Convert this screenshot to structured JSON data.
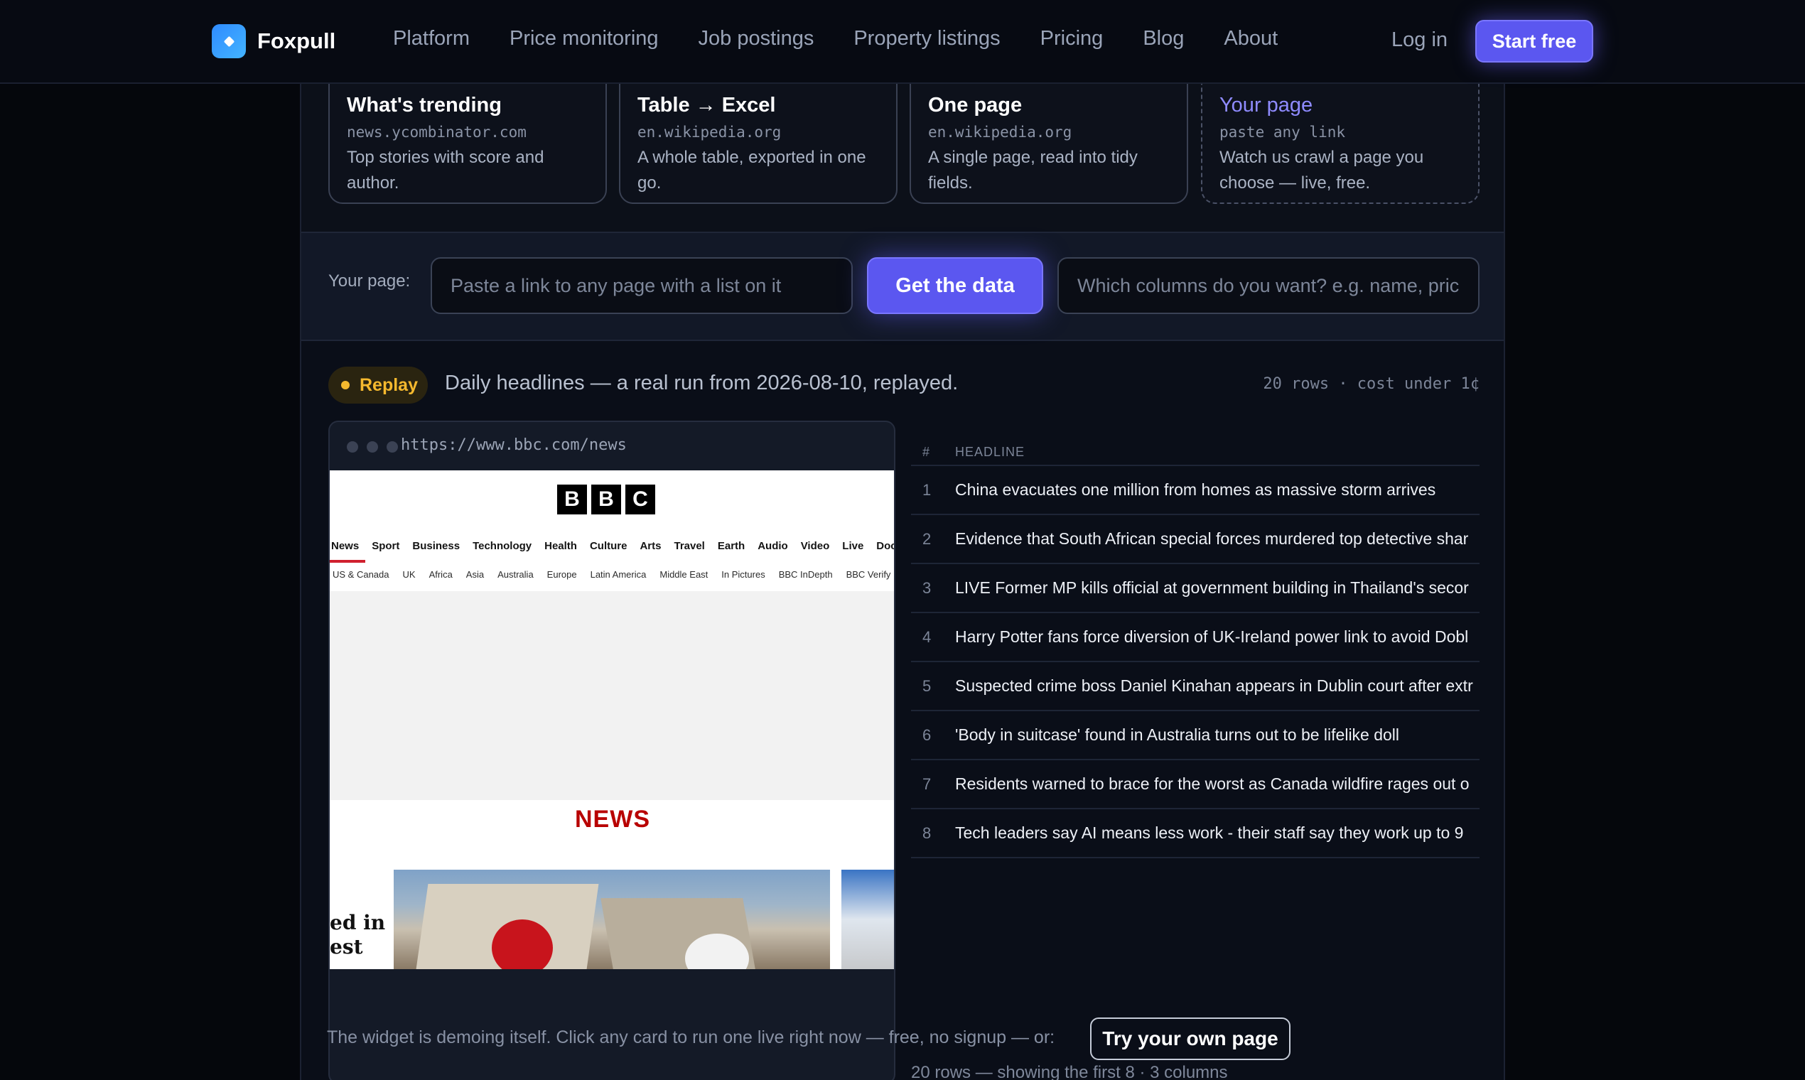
{
  "nav": {
    "brand": "Foxpull",
    "links": [
      "Platform",
      "Price monitoring",
      "Job postings",
      "Property listings",
      "Pricing",
      "Blog",
      "About"
    ],
    "login": "Log in",
    "cta": "Start free"
  },
  "cards": [
    {
      "title": "What's trending",
      "domain": "news.ycombinator.com",
      "desc": "Top stories with score and author."
    },
    {
      "title": "Table → Excel",
      "domain": "en.wikipedia.org",
      "desc": "A whole table, exported in one go."
    },
    {
      "title": "One page",
      "domain": "en.wikipedia.org",
      "desc": "A single page, read into tidy fields."
    },
    {
      "title": "Your page",
      "domain": "paste any link",
      "desc": "Watch us crawl a page you choose — live, free."
    }
  ],
  "input_row": {
    "label": "Your page:",
    "url_placeholder": "Paste a link to any page with a list on it",
    "button": "Get the data",
    "columns_placeholder": "Which columns do you want? e.g. name, price"
  },
  "replay": {
    "badge": "Replay",
    "title": "Daily headlines — a real run from 2026-08-10, replayed.",
    "meta": "20 rows · cost under 1¢"
  },
  "browser": {
    "url": "https://www.bbc.com/news",
    "logo_letters": [
      "B",
      "B",
      "C"
    ],
    "nav": [
      "News",
      "Sport",
      "Business",
      "Technology",
      "Health",
      "Culture",
      "Arts",
      "Travel",
      "Earth",
      "Audio",
      "Video",
      "Live",
      "Documentaries"
    ],
    "subnav": [
      "US & Canada",
      "UK",
      "Africa",
      "Asia",
      "Australia",
      "Europe",
      "Latin America",
      "Middle East",
      "In Pictures",
      "BBC InDepth",
      "BBC Verify"
    ],
    "section": "NEWS",
    "edge_text": [
      "ed in",
      "est"
    ]
  },
  "table": {
    "headers": [
      "#",
      "HEADLINE"
    ],
    "rows": [
      {
        "n": "1",
        "headline": "China evacuates one million from homes as massive storm arrives"
      },
      {
        "n": "2",
        "headline": "Evidence that South African special forces murdered top detective shar"
      },
      {
        "n": "3",
        "headline": "LIVE Former MP kills official at government building in Thailand's secor"
      },
      {
        "n": "4",
        "headline": "Harry Potter fans force diversion of UK-Ireland power link to avoid Dobl"
      },
      {
        "n": "5",
        "headline": "Suspected crime boss Daniel Kinahan appears in Dublin court after extr"
      },
      {
        "n": "6",
        "headline": "'Body in suitcase' found in Australia turns out to be lifelike doll"
      },
      {
        "n": "7",
        "headline": "Residents warned to brace for the worst as Canada wildfire rages out o"
      },
      {
        "n": "8",
        "headline": "Tech leaders say AI means less work - their staff say they work up to 9"
      }
    ],
    "footer": "20 rows — showing the first 8 · 3 columns"
  },
  "bottom": {
    "text": "The widget is demoing itself. Click any card to run one live right now — free, no signup — or:",
    "button": "Try your own page"
  }
}
